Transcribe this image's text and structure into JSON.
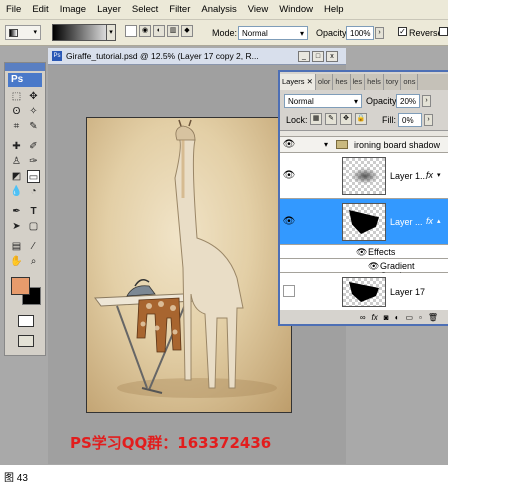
{
  "menu": [
    "File",
    "Edit",
    "Image",
    "Layer",
    "Select",
    "Filter",
    "Analysis",
    "View",
    "Window",
    "Help"
  ],
  "options": {
    "mode_label": "Mode:",
    "mode_value": "Normal",
    "opacity_label": "Opacity:",
    "opacity_value": "100%",
    "reverse_label": "Reverse",
    "extra_label": "D"
  },
  "toolbox": {
    "logo": "Ps"
  },
  "document": {
    "title": "Giraffe_tutorial.psd @ 12.5% (Layer 17 copy 2, R..."
  },
  "layers": {
    "tabs": [
      "Layers",
      "olor",
      "hes",
      "les",
      "hels",
      "tory",
      "ons"
    ],
    "blend_mode": "Normal",
    "opacity_label": "Opacity:",
    "opacity_value": "20%",
    "lock_label": "Lock:",
    "fill_label": "Fill:",
    "fill_value": "0%",
    "group_name": "ironing board shadow",
    "layer1_name": "Layer 1...",
    "layer2_name": "Layer ...",
    "effects_label": "Effects",
    "gradient_label": "Gradient Overlay",
    "layer17_name": "Layer 17",
    "fx": "fx"
  },
  "caption": "PS学习QQ群：163372436",
  "figure_label": "图 43",
  "colors": {
    "accent_selected": "#3399ff",
    "caption_red": "#e21d1d",
    "foreground_swatch": "#e79b6c",
    "background_swatch": "#000000"
  },
  "icons": [
    "visibility-eye-icon",
    "folder-icon",
    "move-tool-icon",
    "marquee-tool-icon",
    "lasso-tool-icon",
    "type-tool-icon",
    "hand-tool-icon",
    "zoom-tool-icon"
  ]
}
